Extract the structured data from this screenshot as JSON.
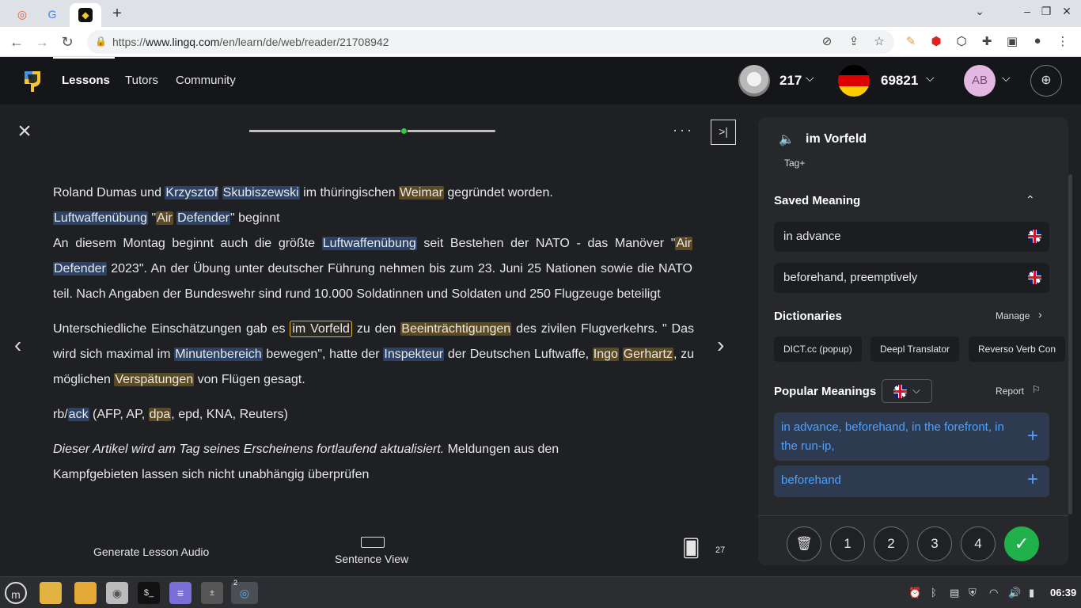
{
  "browser": {
    "address": {
      "prefix": "https://",
      "domain": "www.lingq.com",
      "path": "/en/learn/de/web/reader/21708942"
    }
  },
  "header": {
    "nav": [
      "Lessons",
      "Tutors",
      "Community"
    ],
    "coins": "217",
    "known_words": "69821",
    "avatar_initials": "AB"
  },
  "reader": {
    "progress_fraction": 0.63,
    "paragraphs": {
      "p1_l1": {
        "a": "Roland Dumas und ",
        "b1": "Krzysztof",
        "s1": " ",
        "b2": "Skubiszewski",
        "c": " im thüringischen ",
        "y1": "Weimar",
        "d": " gegründet worden."
      },
      "p1_l2": {
        "b1": "Luftwaffenübung",
        "a": " \"",
        "y1": "Air",
        "s": " ",
        "b2": "Defender",
        "c": "\" beginnt"
      },
      "p2": {
        "a": "An diesem Montag beginnt auch die größte ",
        "b1": "Luftwaffenübung",
        "b": " seit Bestehen der NATO - das Manöver \"",
        "y1": "Air",
        "s": " ",
        "b2": "Defender",
        "c": " 2023\".  An der Übung unter deutscher Führung nehmen bis zum 23. Juni 25 Nationen sowie die NATO teil.  Nach Angaben der Bundeswehr sind rund 10.000 Soldatinnen und Soldaten und 250 Flugzeuge beteiligt"
      },
      "p3": {
        "a": "Unterschiedliche Einschätzungen gab es ",
        "sel": "im Vorfeld",
        "b": " zu den ",
        "y1": "Beeinträchtigungen",
        "c": " des zivilen Flugverkehrs. \" Das wird sich maximal im ",
        "b1": "Minutenbereich",
        "d": " bewegen\", hatte der ",
        "b2": "Inspekteur",
        "e": " der Deutschen Luftwaffe, ",
        "y2": "Ingo",
        "s": " ",
        "y3": "Gerhartz",
        "f": ", zu möglichen ",
        "y4": "Verspätungen",
        "g": " von Flügen gesagt."
      },
      "p4": {
        "a": "rb/",
        "b1": "ack",
        "b": " (AFP, AP, ",
        "y1": "dpa",
        "c": ", epd, KNA, Reuters)"
      },
      "p5": {
        "it": "Dieser Artikel wird am Tag seines Erscheinens fortlaufend aktualisiert.",
        "a": "  Meldungen aus den Kampfgebieten lassen sich nicht unabhängig überprüfen"
      }
    },
    "footer": {
      "generate_audio": "Generate Lesson Audio",
      "sentence_view": "Sentence View",
      "cards_count": "27"
    }
  },
  "panel": {
    "term": "im Vorfeld",
    "tag_label": "Tag+",
    "saved_meaning_title": "Saved Meaning",
    "saved_meanings": [
      "in advance",
      "beforehand, preemptively"
    ],
    "dictionaries_title": "Dictionaries",
    "manage_label": "Manage",
    "dictionaries": [
      "DICT.cc (popup)",
      "Deepl Translator",
      "Reverso Verb Con"
    ],
    "popular_title": "Popular Meanings",
    "report_label": "Report",
    "popular_meanings": [
      "in advance, beforehand, in the forefront, in the run-ip,",
      "beforehand"
    ],
    "status_levels": [
      "1",
      "2",
      "3",
      "4"
    ],
    "status_known": "✓"
  },
  "taskbar": {
    "clock": "06:39",
    "badge": "2"
  },
  "colors": {
    "known_blue": "#2c4366",
    "lingq_yellow": "#5c4a22",
    "accent_green": "#20b14a",
    "link_blue": "#4ea2ff"
  },
  "icons": [
    "close-icon",
    "more-icon",
    "sidebar-toggle-icon",
    "speaker-icon",
    "chevron-up-icon",
    "chevron-right-icon",
    "chevron-down-icon",
    "plus-icon",
    "trash-icon",
    "check-icon",
    "flashcards-icon",
    "sentence-view-icon",
    "flag-icon"
  ]
}
